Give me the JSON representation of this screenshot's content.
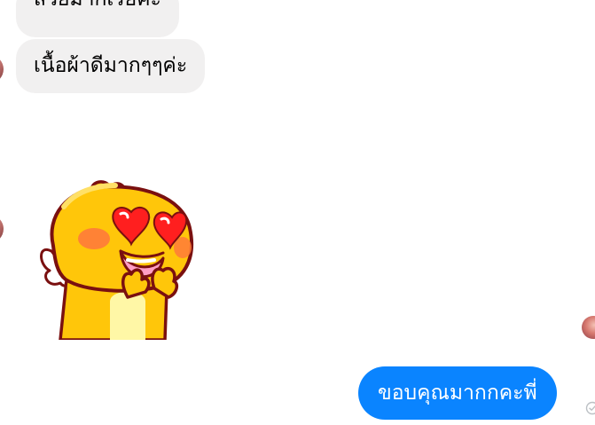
{
  "messages": [
    {
      "direction": "incoming",
      "text": "สวยมากเรยค่ะ"
    },
    {
      "direction": "incoming",
      "text": "เนื้อผ้าดีมากๆๆค่ะ"
    },
    {
      "direction": "incoming",
      "sticker": "qoobee-heart-eyes-sticker"
    },
    {
      "direction": "outgoing",
      "text": "ขอบคุณมากกคะพี่"
    }
  ],
  "colors": {
    "incoming_bubble": "#f1f0f0",
    "outgoing_bubble": "#0a84ff",
    "outgoing_text": "#ffffff",
    "incoming_text": "#000000"
  },
  "icons": {
    "seen_status": "check-circle-icon"
  }
}
